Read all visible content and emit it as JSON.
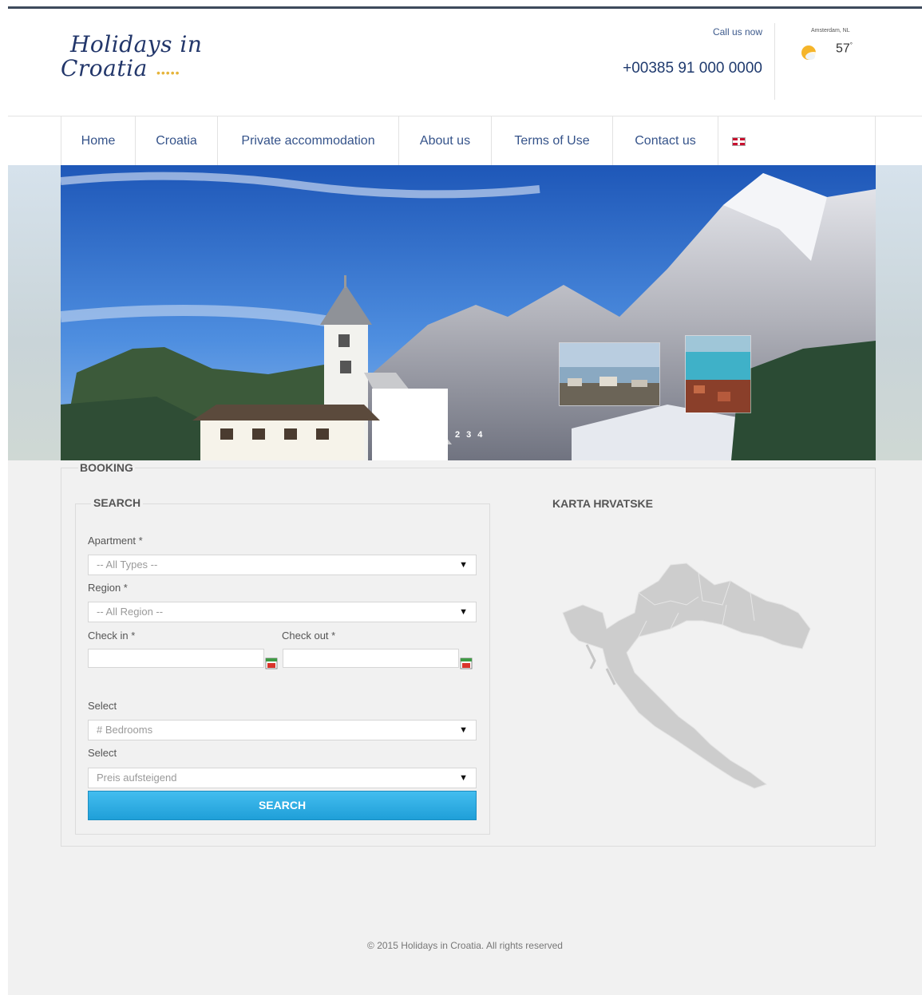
{
  "header": {
    "logo_line1": "Holidays in",
    "logo_line2": "Croatia",
    "call_label": "Call us now",
    "phone": "+00385 91 000 0000",
    "weather": {
      "city": "Amsterdam, NL",
      "temperature": "57",
      "icon": "partly-sunny-icon"
    }
  },
  "nav": {
    "items": [
      {
        "label": "Home"
      },
      {
        "label": "Croatia"
      },
      {
        "label": "Private accommodation"
      },
      {
        "label": "About us"
      },
      {
        "label": "Terms of Use"
      },
      {
        "label": "Contact us"
      }
    ],
    "language_icon": "uk-flag-icon"
  },
  "slider": {
    "pages": [
      "2",
      "3",
      "4"
    ]
  },
  "booking": {
    "title": "BOOKING",
    "search": {
      "title": "SEARCH",
      "apartment_label": "Apartment *",
      "apartment_value": "-- All Types --",
      "region_label": "Region *",
      "region_value": "-- All Region --",
      "checkin_label": "Check in *",
      "checkout_label": "Check out *",
      "bedrooms_label": "Select",
      "bedrooms_value": "# Bedrooms",
      "sort_label": "Select",
      "sort_value": "Preis aufsteigend",
      "button_label": "SEARCH"
    },
    "map_title": "KARTA HRVATSKE"
  },
  "footer": {
    "text": "© 2015 Holidays in Croatia. All rights reserved"
  },
  "colors": {
    "nav_text": "#35538a",
    "button": "#2aa9e0",
    "topline": "#3e4a5c"
  }
}
